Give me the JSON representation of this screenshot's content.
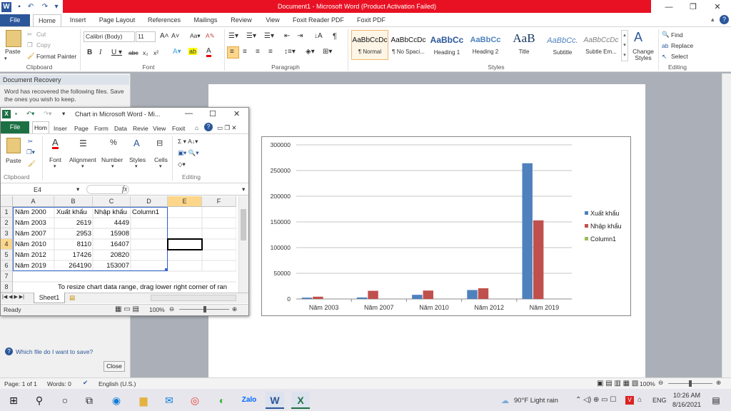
{
  "window": {
    "title": "Document1 - Microsoft Word (Product Activation Failed)",
    "minimize": "—",
    "restore": "❐",
    "close": "✕"
  },
  "ribbon": {
    "tabs": [
      "File",
      "Home",
      "Insert",
      "Page Layout",
      "References",
      "Mailings",
      "Review",
      "View",
      "Foxit Reader PDF",
      "Foxit PDF"
    ],
    "clipboard": {
      "paste": "Paste",
      "cut": "Cut",
      "copy": "Copy",
      "format_painter": "Format Painter",
      "label": "Clipboard"
    },
    "font": {
      "name": "Calibri (Body)",
      "size": "11",
      "label": "Font"
    },
    "paragraph": {
      "label": "Paragraph"
    },
    "styles": {
      "label": "Styles",
      "items": [
        {
          "sample": "AaBbCcDc",
          "name": "¶ Normal"
        },
        {
          "sample": "AaBbCcDc",
          "name": "¶ No Spaci..."
        },
        {
          "sample": "AaBbCc",
          "name": "Heading 1"
        },
        {
          "sample": "AaBbCc",
          "name": "Heading 2"
        },
        {
          "sample": "AaB",
          "name": "Title"
        },
        {
          "sample": "AaBbCc.",
          "name": "Subtitle"
        },
        {
          "sample": "AaBbCcDc",
          "name": "Subtle Em..."
        }
      ],
      "change_styles": "Change Styles"
    },
    "editing": {
      "find": "Find",
      "replace": "Replace",
      "select": "Select",
      "label": "Editing"
    }
  },
  "recovery": {
    "title": "Document Recovery",
    "text": "Word has recovered the following files. Save the ones you wish to keep.",
    "link": "Which file do I want to save?",
    "close": "Close"
  },
  "excel": {
    "title": "Chart in Microsoft Word - Mi...",
    "tabs": [
      "File",
      "Hom",
      "Inser",
      "Page",
      "Form",
      "Data",
      "Revie",
      "View",
      "Foxit"
    ],
    "groups": {
      "paste": "Paste",
      "font": "Font",
      "alignment": "Alignment",
      "number": "Number",
      "styles": "Styles",
      "cells": "Cells",
      "clipboard": "Clipboard",
      "editing": "Editing"
    },
    "name_box": "E4",
    "fx": "fx",
    "columns": [
      "A",
      "B",
      "C",
      "D",
      "E",
      "F"
    ],
    "rows": [
      [
        "Năm 2000",
        "Xuất khẩu",
        "Nhập khẩu",
        "Column1"
      ],
      [
        "Năm 2003",
        "2619",
        "4449",
        ""
      ],
      [
        "Năm 2007",
        "2953",
        "15908",
        ""
      ],
      [
        "Năm 2010",
        "8110",
        "16407",
        ""
      ],
      [
        "Năm 2012",
        "17426",
        "20820",
        ""
      ],
      [
        "Năm 2019",
        "264190",
        "153007",
        ""
      ]
    ],
    "row_numbers": [
      "1",
      "2",
      "3",
      "4",
      "5",
      "6",
      "7",
      "8"
    ],
    "hint": "To resize chart data range, drag lower right corner of ran",
    "sheet": "Sheet1",
    "status": "Ready",
    "zoom": "100%"
  },
  "chart_data": {
    "type": "bar",
    "categories": [
      "Năm 2003",
      "Năm 2007",
      "Năm 2010",
      "Năm 2012",
      "Năm 2019"
    ],
    "series": [
      {
        "name": "Xuất  khẩu",
        "values": [
          2619,
          2953,
          8110,
          17426,
          264190
        ],
        "color": "#4f81bd"
      },
      {
        "name": "Nhập  khẩu",
        "values": [
          4449,
          15908,
          16407,
          20820,
          153007
        ],
        "color": "#c0504d"
      },
      {
        "name": "Column1",
        "values": [
          0,
          0,
          0,
          0,
          0
        ],
        "color": "#9bbb59"
      }
    ],
    "yticks": [
      "0",
      "50000",
      "100000",
      "150000",
      "200000",
      "250000",
      "300000"
    ],
    "ylim": [
      0,
      300000
    ],
    "legend": "right",
    "grid": true
  },
  "statusbar": {
    "page": "Page: 1 of 1",
    "words": "Words: 0",
    "language": "English (U.S.)",
    "zoom": "100%"
  },
  "taskbar": {
    "weather": "90°F  Light rain",
    "lang": "ENG",
    "time": "10:26 AM",
    "date": "8/16/2021"
  }
}
